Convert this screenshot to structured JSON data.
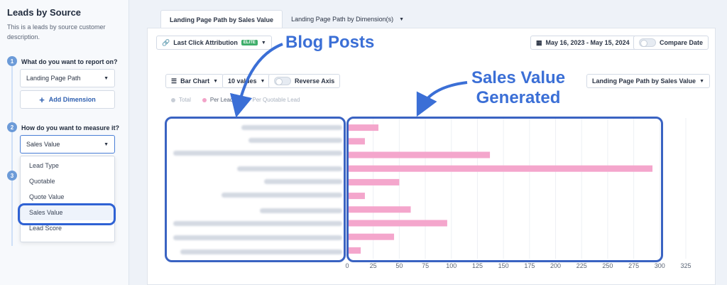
{
  "sidebar": {
    "title": "Leads by Source",
    "description": "This is a leads by source customer description.",
    "steps": [
      {
        "num": "1",
        "label": "What do you want to report on?"
      },
      {
        "num": "2",
        "label": "How do you want to measure it?"
      },
      {
        "num": "3"
      }
    ],
    "report_on_value": "Landing Page Path",
    "add_dimension_label": "Add Dimension",
    "measure_value": "Sales Value",
    "measure_options": [
      "Lead Type",
      "Quotable",
      "Quote Value",
      "Sales Value",
      "Lead Score"
    ],
    "selected_option": "Sales Value"
  },
  "tabs": [
    {
      "label": "Landing Page Path by Sales Value",
      "active": true
    },
    {
      "label": "Landing Page Path by Dimension(s)",
      "active": false
    }
  ],
  "toolbar": {
    "attribution": "Last Click Attribution",
    "elite_badge": "ELITE",
    "date_range": "May 16, 2023 - May 15, 2024",
    "compare_label": "Compare Date"
  },
  "chart_controls": {
    "chart_type": "Bar Chart",
    "values_count": "10 values",
    "reverse_axis": "Reverse Axis",
    "series_selector": "Landing Page Path by Sales Value"
  },
  "legend": {
    "items": [
      "Total",
      "Per Lead",
      "Per Quotable Lead"
    ],
    "active": "Per Lead",
    "colors": [
      "#c7cdd6",
      "#f2a3c8",
      "#c7cdd6"
    ]
  },
  "annotations": {
    "blog_posts": "Blog Posts",
    "sales_value": "Sales Value Generated"
  },
  "chart_data": {
    "type": "bar",
    "orientation": "horizontal",
    "series": [
      {
        "values": [
          30,
          17,
          137,
          293,
          50,
          17,
          61,
          96,
          45,
          13
        ]
      }
    ],
    "xlim": [
      0,
      325
    ],
    "xticks": [
      0,
      25,
      50,
      75,
      100,
      125,
      150,
      175,
      200,
      225,
      250,
      275,
      300,
      325
    ],
    "bar_color": "#f4a6cc",
    "grid": true
  }
}
